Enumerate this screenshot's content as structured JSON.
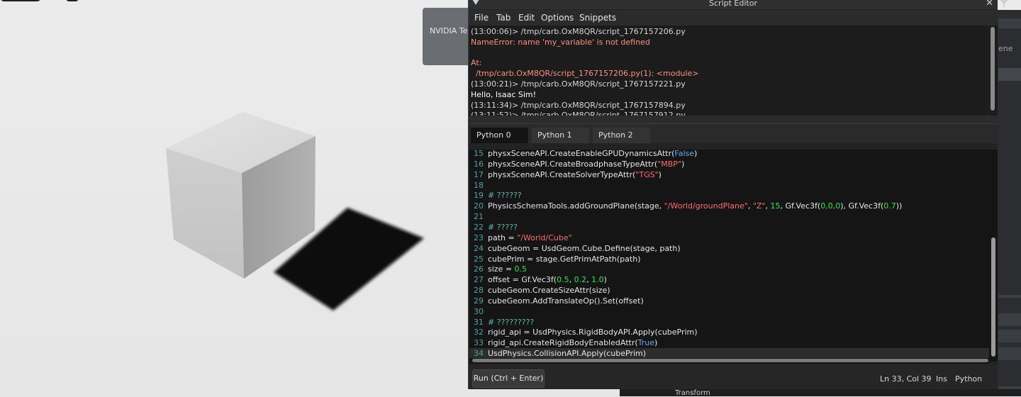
{
  "notification": {
    "text": "NVIDIA Te"
  },
  "script_editor": {
    "title": "Script Editor",
    "menu": [
      "File",
      "Tab",
      "Edit",
      "Options",
      "Snippets"
    ],
    "console_lines": [
      {
        "text": "(13:00:06)> /tmp/carb.OxM8QR/script_1767157206.py",
        "style": "normal"
      },
      {
        "text": "NameError: name 'my_variable' is not defined",
        "style": "err"
      },
      {
        "text": "",
        "style": "normal"
      },
      {
        "text": "At:",
        "style": "err"
      },
      {
        "text": "  /tmp/carb.OxM8QR/script_1767157206.py(1): <module>",
        "style": "err"
      },
      {
        "text": "(13:00:21)> /tmp/carb.OxM8QR/script_1767157221.py",
        "style": "normal"
      },
      {
        "text": "Hello, Isaac Sim!",
        "style": "bold"
      },
      {
        "text": "(13:11:34)> /tmp/carb.OxM8QR/script_1767157894.py",
        "style": "normal"
      },
      {
        "text": "(13:11:52)> /tmp/carb.OxM8QR/script_1767157912.py",
        "style": "normal"
      }
    ],
    "tabs": [
      "Python 0",
      "Python 1",
      "Python 2"
    ],
    "active_tab": "Python 0",
    "code_lines": [
      {
        "n": "15",
        "parts": [
          [
            "t",
            "physxSceneAPI.CreateEnableGPUDynamicsAttr("
          ],
          [
            "b",
            "False"
          ],
          [
            "t",
            ")"
          ]
        ]
      },
      {
        "n": "16",
        "parts": [
          [
            "t",
            "physxSceneAPI.CreateBroadphaseTypeAttr("
          ],
          [
            "s",
            "\"MBP\""
          ],
          [
            "t",
            ")"
          ]
        ]
      },
      {
        "n": "17",
        "parts": [
          [
            "t",
            "physxSceneAPI.CreateSolverTypeAttr("
          ],
          [
            "s",
            "\"TGS\""
          ],
          [
            "t",
            ")"
          ]
        ]
      },
      {
        "n": "18",
        "parts": []
      },
      {
        "n": "19",
        "parts": [
          [
            "c",
            "# ??????"
          ]
        ]
      },
      {
        "n": "20",
        "parts": [
          [
            "t",
            "PhysicsSchemaTools.addGroundPlane(stage, "
          ],
          [
            "s",
            "\"/World/groundPlane\""
          ],
          [
            "t",
            ", "
          ],
          [
            "s",
            "\"Z\""
          ],
          [
            "t",
            ", "
          ],
          [
            "n",
            "15"
          ],
          [
            "t",
            ", Gf.Vec3f("
          ],
          [
            "n",
            "0,0,0"
          ],
          [
            "t",
            "), Gf.Vec3f("
          ],
          [
            "n",
            "0.7"
          ],
          [
            "t",
            "))"
          ]
        ]
      },
      {
        "n": "21",
        "parts": []
      },
      {
        "n": "22",
        "parts": [
          [
            "c",
            "# ?????"
          ]
        ]
      },
      {
        "n": "23",
        "parts": [
          [
            "t",
            "path = "
          ],
          [
            "s",
            "\"/World/Cube\""
          ]
        ]
      },
      {
        "n": "24",
        "parts": [
          [
            "t",
            "cubeGeom = UsdGeom.Cube.Define(stage, path)"
          ]
        ]
      },
      {
        "n": "25",
        "parts": [
          [
            "t",
            "cubePrim = stage.GetPrimAtPath(path)"
          ]
        ]
      },
      {
        "n": "26",
        "parts": [
          [
            "t",
            "size = "
          ],
          [
            "n",
            "0.5"
          ]
        ]
      },
      {
        "n": "27",
        "parts": [
          [
            "t",
            "offset = Gf.Vec3f("
          ],
          [
            "n",
            "0.5"
          ],
          [
            "t",
            ", "
          ],
          [
            "n",
            "0.2"
          ],
          [
            "t",
            ", "
          ],
          [
            "n",
            "1.0"
          ],
          [
            "t",
            ")"
          ]
        ]
      },
      {
        "n": "28",
        "parts": [
          [
            "t",
            "cubeGeom.CreateSizeAttr(size)"
          ]
        ]
      },
      {
        "n": "29",
        "parts": [
          [
            "t",
            "cubeGeom.AddTranslateOp().Set(offset)"
          ]
        ]
      },
      {
        "n": "30",
        "parts": []
      },
      {
        "n": "31",
        "parts": [
          [
            "c",
            "# ?????????"
          ]
        ]
      },
      {
        "n": "32",
        "parts": [
          [
            "t",
            "rigid_api = UsdPhysics.RigidBodyAPI.Apply(cubePrim)"
          ]
        ]
      },
      {
        "n": "33",
        "parts": [
          [
            "t",
            "rigid_api.CreateRigidBodyEnabledAttr("
          ],
          [
            "b",
            "True"
          ],
          [
            "t",
            ")"
          ]
        ]
      },
      {
        "n": "34",
        "parts": [
          [
            "t",
            "UsdPhysics.CollisionAPI.Apply(cubePrim)"
          ]
        ]
      }
    ],
    "current_line": "34",
    "run_button": "Run (Ctrl + Enter)",
    "status": {
      "cursor": "Ln 33, Col 39",
      "mode": "Ins",
      "language": "Python"
    }
  },
  "right_panel": {
    "partial_text": "ene"
  },
  "property_panel": {
    "section": "Transform"
  },
  "colors": {
    "code_bool": "#6aa8f2",
    "code_string": "#ff6b6b",
    "code_number": "#2fe84c",
    "code_comment": "#5fb8b0",
    "error_text": "#ff8f7e"
  }
}
